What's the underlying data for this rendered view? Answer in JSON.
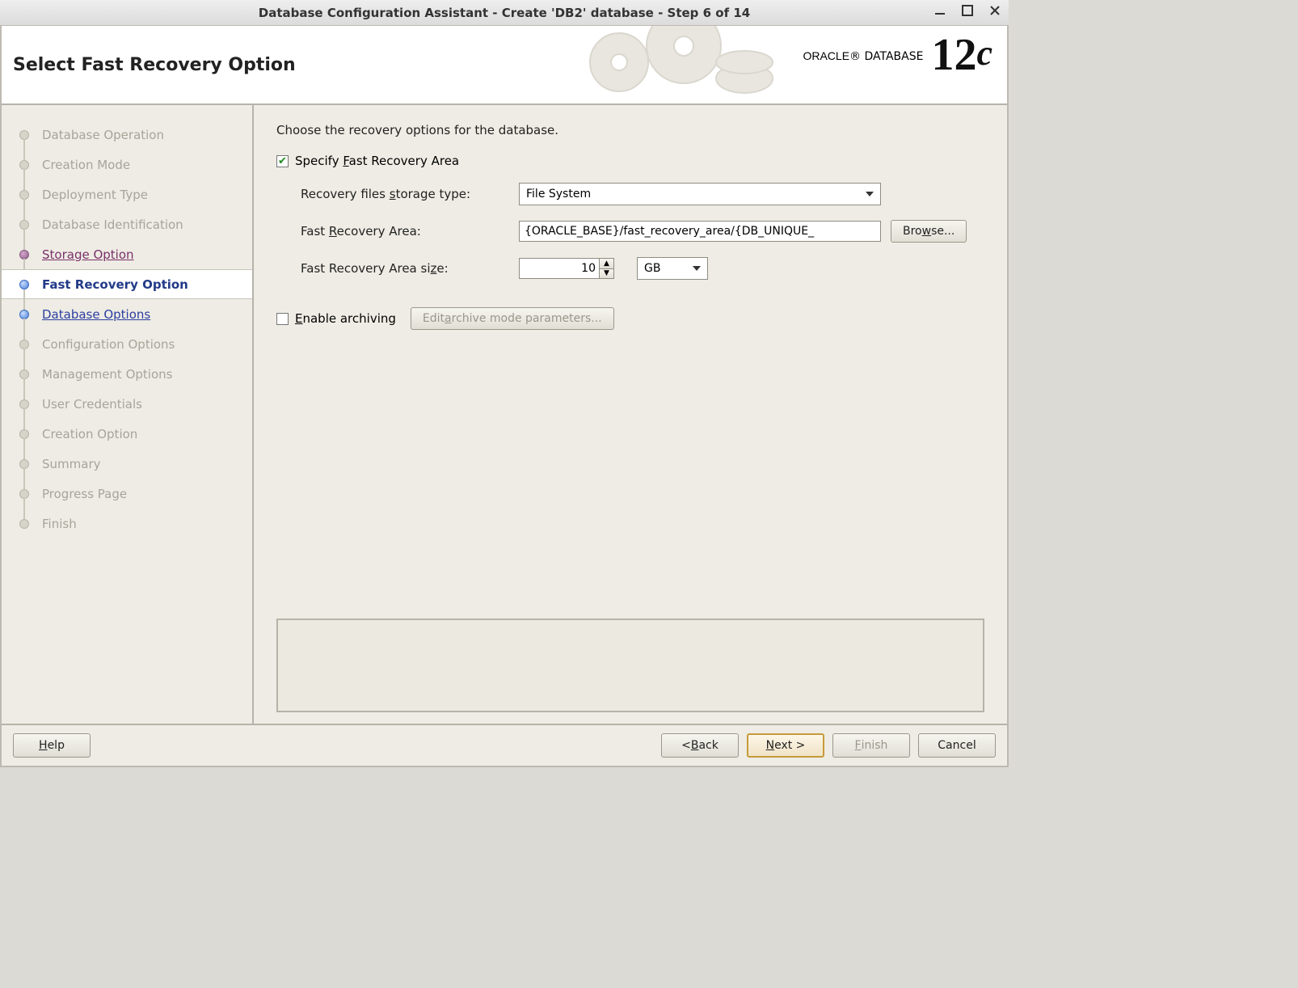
{
  "titlebar": {
    "title": "Database Configuration Assistant - Create 'DB2' database - Step 6 of 14"
  },
  "header": {
    "page_title": "Select Fast Recovery Option",
    "logo_brand": "ORACLE",
    "logo_product": "DATABASE",
    "logo_version_number": "12",
    "logo_version_suffix": "c"
  },
  "sidebar": {
    "steps": [
      {
        "label": "Database Operation",
        "state": "disabled"
      },
      {
        "label": "Creation Mode",
        "state": "disabled"
      },
      {
        "label": "Deployment Type",
        "state": "disabled"
      },
      {
        "label": "Database Identification",
        "state": "disabled"
      },
      {
        "label": "Storage Option",
        "state": "visited-link"
      },
      {
        "label": "Fast Recovery Option",
        "state": "current"
      },
      {
        "label": "Database Options",
        "state": "upcoming-link"
      },
      {
        "label": "Configuration Options",
        "state": "disabled"
      },
      {
        "label": "Management Options",
        "state": "disabled"
      },
      {
        "label": "User Credentials",
        "state": "disabled"
      },
      {
        "label": "Creation Option",
        "state": "disabled"
      },
      {
        "label": "Summary",
        "state": "disabled"
      },
      {
        "label": "Progress Page",
        "state": "disabled"
      },
      {
        "label": "Finish",
        "state": "disabled"
      }
    ]
  },
  "main": {
    "instruction": "Choose the recovery options for the database.",
    "specify_fra": {
      "label": "Specify Fast Recovery Area",
      "accesskey_idx": 8,
      "checked": true
    },
    "storage_type": {
      "label": "Recovery files storage type:",
      "accesskey_idx": 15,
      "value": "File System"
    },
    "fra_path": {
      "label": "Fast Recovery Area:",
      "accesskey_idx": 5,
      "value": "{ORACLE_BASE}/fast_recovery_area/{DB_UNIQUE_"
    },
    "browse_btn": {
      "label": "Browse...",
      "accesskey_idx": 3
    },
    "fra_size": {
      "label": "Fast Recovery Area size:",
      "accesskey_idx": 21,
      "value": "10",
      "unit": "GB"
    },
    "archiving": {
      "label": "Enable archiving",
      "accesskey_idx": 0,
      "checked": false
    },
    "edit_archive": {
      "label": "Edit archive mode parameters...",
      "accesskey_idx": 5
    }
  },
  "footer": {
    "help": {
      "label": "Help",
      "accesskey_idx": 0
    },
    "back": {
      "label": "< Back",
      "accesskey_idx": 2
    },
    "next": {
      "label": "Next >",
      "accesskey_idx": 0
    },
    "finish": {
      "label": "Finish",
      "accesskey_idx": 0,
      "disabled": true
    },
    "cancel": {
      "label": "Cancel"
    }
  }
}
